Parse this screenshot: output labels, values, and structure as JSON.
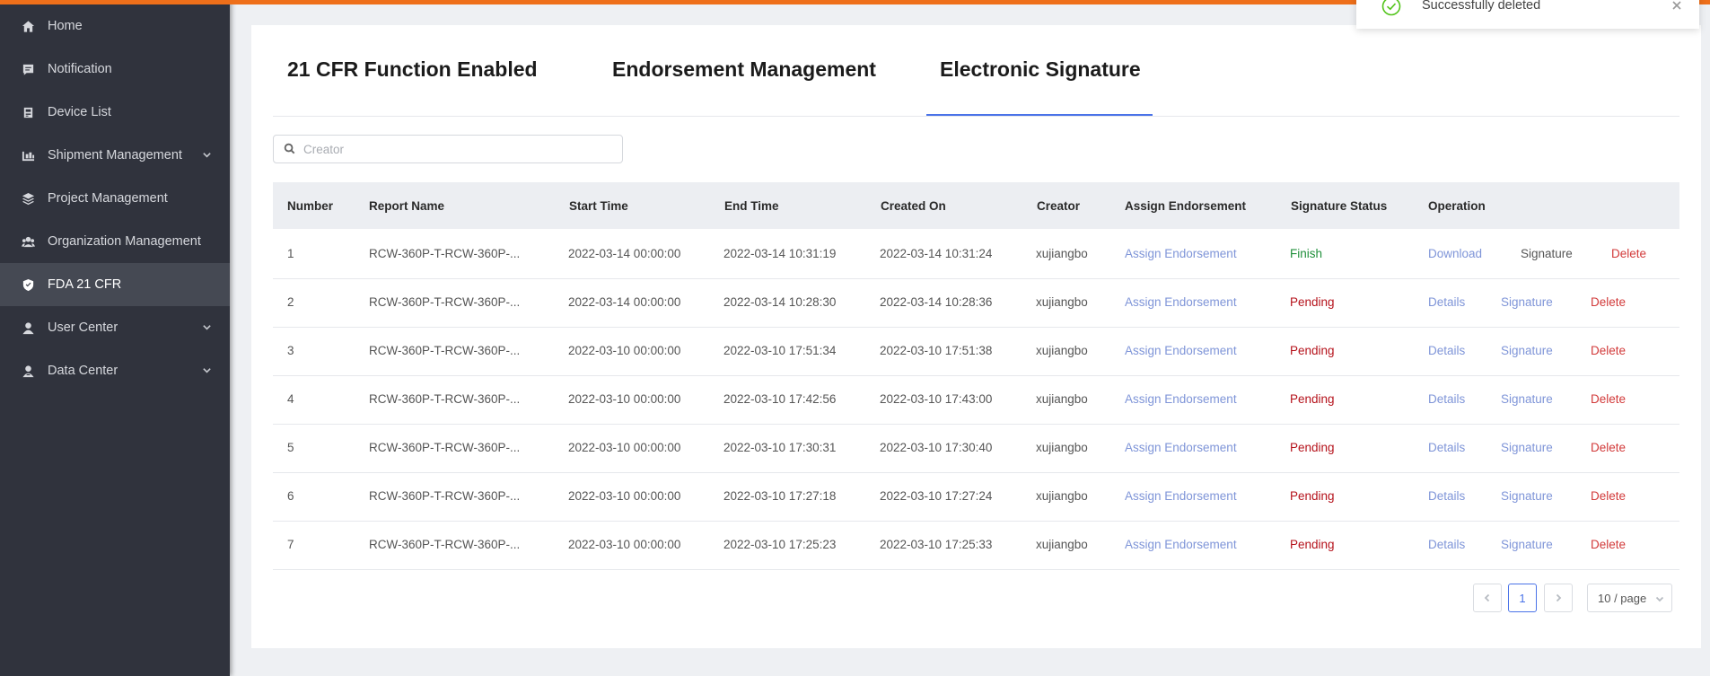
{
  "sidebar": {
    "items": [
      {
        "label": "Home",
        "icon": "home-icon"
      },
      {
        "label": "Notification",
        "icon": "message-icon"
      },
      {
        "label": "Device List",
        "icon": "device-icon"
      },
      {
        "label": "Shipment Management",
        "icon": "shipment-icon",
        "expandable": true
      },
      {
        "label": "Project Management",
        "icon": "layers-icon"
      },
      {
        "label": "Organization Management",
        "icon": "organization-icon"
      },
      {
        "label": "FDA 21 CFR",
        "icon": "shield-icon",
        "active": true
      },
      {
        "label": "User Center",
        "icon": "user-icon",
        "expandable": true
      },
      {
        "label": "Data Center",
        "icon": "data-user-icon",
        "expandable": true
      }
    ]
  },
  "tabs": [
    {
      "label": "21 CFR Function Enabled"
    },
    {
      "label": "Endorsement Management"
    },
    {
      "label": "Electronic Signature",
      "active": true
    }
  ],
  "search": {
    "placeholder": "Creator",
    "value": ""
  },
  "table": {
    "columns": [
      "Number",
      "Report Name",
      "Start Time",
      "End Time",
      "Created On",
      "Creator",
      "Assign Endorsement",
      "Signature Status",
      "Operation"
    ],
    "rows": [
      {
        "number": "1",
        "report": "RCW-360P-T-RCW-360P-...",
        "start": "2022-03-14 00:00:00",
        "end": "2022-03-14 10:31:19",
        "created": "2022-03-14 10:31:24",
        "creator": "xujiangbo",
        "assign": "Assign Endorsement",
        "status": "Finish",
        "op1": "Download",
        "op2": "Signature",
        "op3": "Delete"
      },
      {
        "number": "2",
        "report": "RCW-360P-T-RCW-360P-...",
        "start": "2022-03-14 00:00:00",
        "end": "2022-03-14 10:28:30",
        "created": "2022-03-14 10:28:36",
        "creator": "xujiangbo",
        "assign": "Assign Endorsement",
        "status": "Pending",
        "op1": "Details",
        "op2": "Signature",
        "op3": "Delete"
      },
      {
        "number": "3",
        "report": "RCW-360P-T-RCW-360P-...",
        "start": "2022-03-10 00:00:00",
        "end": "2022-03-10 17:51:34",
        "created": "2022-03-10 17:51:38",
        "creator": "xujiangbo",
        "assign": "Assign Endorsement",
        "status": "Pending",
        "op1": "Details",
        "op2": "Signature",
        "op3": "Delete"
      },
      {
        "number": "4",
        "report": "RCW-360P-T-RCW-360P-...",
        "start": "2022-03-10 00:00:00",
        "end": "2022-03-10 17:42:56",
        "created": "2022-03-10 17:43:00",
        "creator": "xujiangbo",
        "assign": "Assign Endorsement",
        "status": "Pending",
        "op1": "Details",
        "op2": "Signature",
        "op3": "Delete"
      },
      {
        "number": "5",
        "report": "RCW-360P-T-RCW-360P-...",
        "start": "2022-03-10 00:00:00",
        "end": "2022-03-10 17:30:31",
        "created": "2022-03-10 17:30:40",
        "creator": "xujiangbo",
        "assign": "Assign Endorsement",
        "status": "Pending",
        "op1": "Details",
        "op2": "Signature",
        "op3": "Delete"
      },
      {
        "number": "6",
        "report": "RCW-360P-T-RCW-360P-...",
        "start": "2022-03-10 00:00:00",
        "end": "2022-03-10 17:27:18",
        "created": "2022-03-10 17:27:24",
        "creator": "xujiangbo",
        "assign": "Assign Endorsement",
        "status": "Pending",
        "op1": "Details",
        "op2": "Signature",
        "op3": "Delete"
      },
      {
        "number": "7",
        "report": "RCW-360P-T-RCW-360P-...",
        "start": "2022-03-10 00:00:00",
        "end": "2022-03-10 17:25:23",
        "created": "2022-03-10 17:25:33",
        "creator": "xujiangbo",
        "assign": "Assign Endorsement",
        "status": "Pending",
        "op1": "Details",
        "op2": "Signature",
        "op3": "Delete"
      }
    ]
  },
  "pagination": {
    "current_page": "1",
    "page_size": "10 / page"
  },
  "toast": {
    "message": "Successfully deleted",
    "icon": "check-circle-icon"
  },
  "colors": {
    "accent": "#4a73e8",
    "top_bar": "#ee6f1a",
    "sidebar": "#30333d",
    "status_finish": "#1f8f3a",
    "status_pending": "#b5121b",
    "link": "#7f95d8",
    "delete": "#d23a3a"
  }
}
